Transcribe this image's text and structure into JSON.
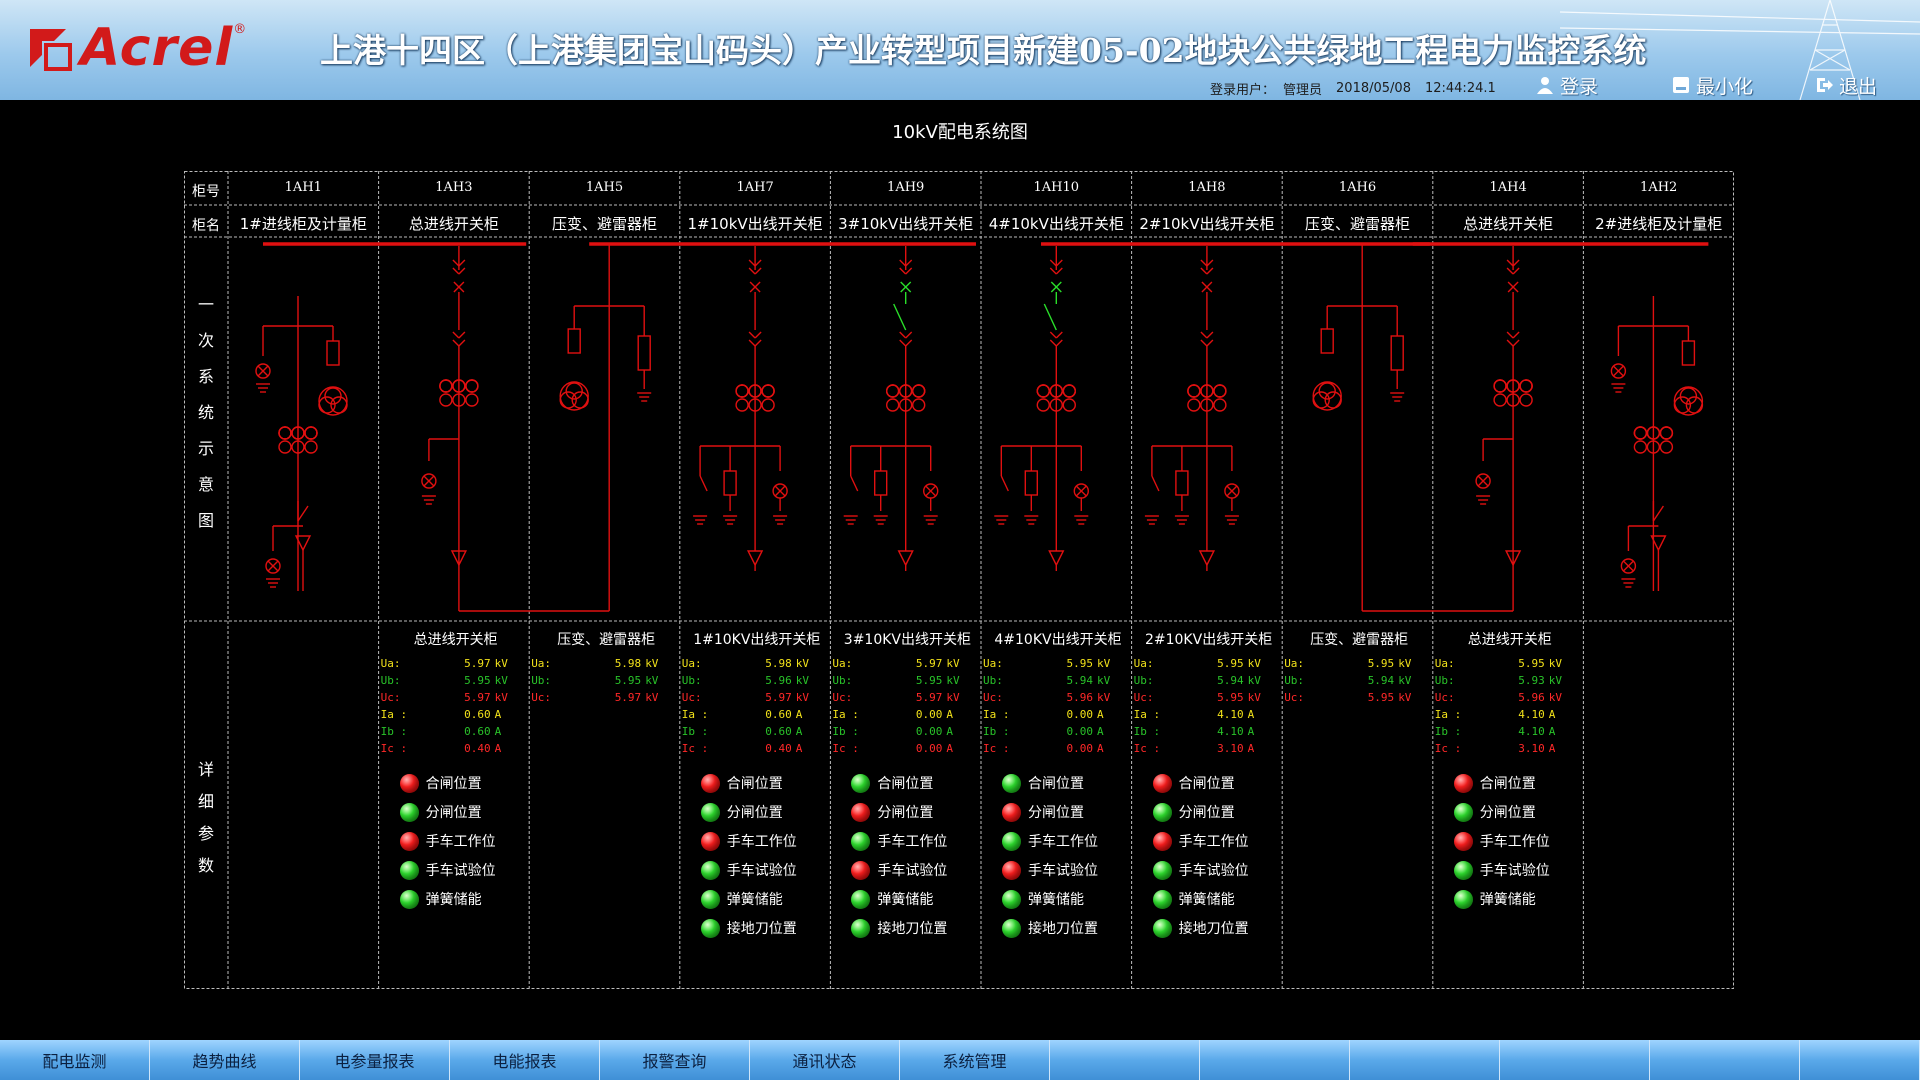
{
  "header": {
    "logo_text": "Acrel",
    "title": "上港十四区（上港集团宝山码头）产业转型项目新建05-02地块公共绿地工程电力监控系统",
    "user_label": "登录用户：",
    "user": "管理员",
    "date": "2018/05/08",
    "time": "12:44:24.1",
    "login_label": "登录",
    "minimize_label": "最小化",
    "exit_label": "退出"
  },
  "page_title": "10kV配电系统图",
  "row_labels": {
    "cabinet_no": "柜号",
    "cabinet_name": "柜名"
  },
  "side_labels": {
    "diagram": [
      "一",
      "次",
      "系",
      "统",
      "示",
      "意",
      "图"
    ],
    "details": [
      "详",
      "细",
      "参",
      "数"
    ]
  },
  "cabinets": [
    {
      "no": "1AH1",
      "name": "1#进线柜及计量柜"
    },
    {
      "no": "1AH3",
      "name": "总进线开关柜"
    },
    {
      "no": "1AH5",
      "name": "压变、避雷器柜"
    },
    {
      "no": "1AH7",
      "name": "1#10kV出线开关柜"
    },
    {
      "no": "1AH9",
      "name": "3#10kV出线开关柜"
    },
    {
      "no": "1AH10",
      "name": "4#10kV出线开关柜"
    },
    {
      "no": "1AH8",
      "name": "2#10kV出线开关柜"
    },
    {
      "no": "1AH6",
      "name": "压变、避雷器柜"
    },
    {
      "no": "1AH4",
      "name": "总进线开关柜"
    },
    {
      "no": "1AH2",
      "name": "2#进线柜及计量柜"
    }
  ],
  "panels": [
    {
      "col": 1,
      "title": "总进线开关柜",
      "rows": [
        {
          "label": "Ua:",
          "value": "5.97",
          "unit": "kV",
          "color": "y"
        },
        {
          "label": "Ub:",
          "value": "5.95",
          "unit": "kV",
          "color": "g"
        },
        {
          "label": "Uc:",
          "value": "5.97",
          "unit": "kV",
          "color": "r"
        },
        {
          "label": "Ia :",
          "value": "0.60",
          "unit": "A",
          "color": "y"
        },
        {
          "label": "Ib :",
          "value": "0.60",
          "unit": "A",
          "color": "g"
        },
        {
          "label": "Ic :",
          "value": "0.40",
          "unit": "A",
          "color": "r"
        }
      ]
    },
    {
      "col": 2,
      "title": "压变、避雷器柜",
      "rows": [
        {
          "label": "Ua:",
          "value": "5.98",
          "unit": "kV",
          "color": "y"
        },
        {
          "label": "Ub:",
          "value": "5.95",
          "unit": "kV",
          "color": "g"
        },
        {
          "label": "Uc:",
          "value": "5.97",
          "unit": "kV",
          "color": "r"
        }
      ]
    },
    {
      "col": 3,
      "title": "1#10KV出线开关柜",
      "rows": [
        {
          "label": "Ua:",
          "value": "5.98",
          "unit": "kV",
          "color": "y"
        },
        {
          "label": "Ub:",
          "value": "5.96",
          "unit": "kV",
          "color": "g"
        },
        {
          "label": "Uc:",
          "value": "5.97",
          "unit": "kV",
          "color": "r"
        },
        {
          "label": "Ia :",
          "value": "0.60",
          "unit": "A",
          "color": "y"
        },
        {
          "label": "Ib :",
          "value": "0.60",
          "unit": "A",
          "color": "g"
        },
        {
          "label": "Ic :",
          "value": "0.40",
          "unit": "A",
          "color": "r"
        }
      ]
    },
    {
      "col": 4,
      "title": "3#10KV出线开关柜",
      "rows": [
        {
          "label": "Ua:",
          "value": "5.97",
          "unit": "kV",
          "color": "y"
        },
        {
          "label": "Ub:",
          "value": "5.95",
          "unit": "kV",
          "color": "g"
        },
        {
          "label": "Uc:",
          "value": "5.97",
          "unit": "kV",
          "color": "r"
        },
        {
          "label": "Ia :",
          "value": "0.00",
          "unit": "A",
          "color": "y"
        },
        {
          "label": "Ib :",
          "value": "0.00",
          "unit": "A",
          "color": "g"
        },
        {
          "label": "Ic :",
          "value": "0.00",
          "unit": "A",
          "color": "r"
        }
      ]
    },
    {
      "col": 5,
      "title": "4#10KV出线开关柜",
      "rows": [
        {
          "label": "Ua:",
          "value": "5.95",
          "unit": "kV",
          "color": "y"
        },
        {
          "label": "Ub:",
          "value": "5.94",
          "unit": "kV",
          "color": "g"
        },
        {
          "label": "Uc:",
          "value": "5.96",
          "unit": "kV",
          "color": "r"
        },
        {
          "label": "Ia :",
          "value": "0.00",
          "unit": "A",
          "color": "y"
        },
        {
          "label": "Ib :",
          "value": "0.00",
          "unit": "A",
          "color": "g"
        },
        {
          "label": "Ic :",
          "value": "0.00",
          "unit": "A",
          "color": "r"
        }
      ]
    },
    {
      "col": 6,
      "title": "2#10KV出线开关柜",
      "rows": [
        {
          "label": "Ua:",
          "value": "5.95",
          "unit": "kV",
          "color": "y"
        },
        {
          "label": "Ub:",
          "value": "5.94",
          "unit": "kV",
          "color": "g"
        },
        {
          "label": "Uc:",
          "value": "5.95",
          "unit": "kV",
          "color": "r"
        },
        {
          "label": "Ia :",
          "value": "4.10",
          "unit": "A",
          "color": "y"
        },
        {
          "label": "Ib :",
          "value": "4.10",
          "unit": "A",
          "color": "g"
        },
        {
          "label": "Ic :",
          "value": "3.10",
          "unit": "A",
          "color": "r"
        }
      ]
    },
    {
      "col": 7,
      "title": "压变、避雷器柜",
      "rows": [
        {
          "label": "Ua:",
          "value": "5.95",
          "unit": "kV",
          "color": "y"
        },
        {
          "label": "Ub:",
          "value": "5.94",
          "unit": "kV",
          "color": "g"
        },
        {
          "label": "Uc:",
          "value": "5.95",
          "unit": "kV",
          "color": "r"
        }
      ]
    },
    {
      "col": 8,
      "title": "总进线开关柜",
      "rows": [
        {
          "label": "Ua:",
          "value": "5.95",
          "unit": "kV",
          "color": "y"
        },
        {
          "label": "Ub:",
          "value": "5.93",
          "unit": "kV",
          "color": "g"
        },
        {
          "label": "Uc:",
          "value": "5.96",
          "unit": "kV",
          "color": "r"
        },
        {
          "label": "Ia :",
          "value": "4.10",
          "unit": "A",
          "color": "y"
        },
        {
          "label": "Ib :",
          "value": "4.10",
          "unit": "A",
          "color": "g"
        },
        {
          "label": "Ic :",
          "value": "3.10",
          "unit": "A",
          "color": "r"
        }
      ]
    }
  ],
  "status": [
    {
      "col": 1,
      "items": [
        {
          "label": "合闸位置",
          "state": "red"
        },
        {
          "label": "分闸位置",
          "state": "green"
        },
        {
          "label": "手车工作位",
          "state": "red"
        },
        {
          "label": "手车试验位",
          "state": "green"
        },
        {
          "label": "弹簧储能",
          "state": "green"
        }
      ]
    },
    {
      "col": 3,
      "items": [
        {
          "label": "合闸位置",
          "state": "red"
        },
        {
          "label": "分闸位置",
          "state": "green"
        },
        {
          "label": "手车工作位",
          "state": "red"
        },
        {
          "label": "手车试验位",
          "state": "green"
        },
        {
          "label": "弹簧储能",
          "state": "green"
        },
        {
          "label": "接地刀位置",
          "state": "green"
        }
      ]
    },
    {
      "col": 4,
      "items": [
        {
          "label": "合闸位置",
          "state": "green"
        },
        {
          "label": "分闸位置",
          "state": "red"
        },
        {
          "label": "手车工作位",
          "state": "green"
        },
        {
          "label": "手车试验位",
          "state": "red"
        },
        {
          "label": "弹簧储能",
          "state": "green"
        },
        {
          "label": "接地刀位置",
          "state": "green"
        }
      ]
    },
    {
      "col": 5,
      "items": [
        {
          "label": "合闸位置",
          "state": "green"
        },
        {
          "label": "分闸位置",
          "state": "red"
        },
        {
          "label": "手车工作位",
          "state": "green"
        },
        {
          "label": "手车试验位",
          "state": "red"
        },
        {
          "label": "弹簧储能",
          "state": "green"
        },
        {
          "label": "接地刀位置",
          "state": "green"
        }
      ]
    },
    {
      "col": 6,
      "items": [
        {
          "label": "合闸位置",
          "state": "red"
        },
        {
          "label": "分闸位置",
          "state": "green"
        },
        {
          "label": "手车工作位",
          "state": "red"
        },
        {
          "label": "手车试验位",
          "state": "green"
        },
        {
          "label": "弹簧储能",
          "state": "green"
        },
        {
          "label": "接地刀位置",
          "state": "green"
        }
      ]
    },
    {
      "col": 8,
      "items": [
        {
          "label": "合闸位置",
          "state": "red"
        },
        {
          "label": "分闸位置",
          "state": "green"
        },
        {
          "label": "手车工作位",
          "state": "red"
        },
        {
          "label": "手车试验位",
          "state": "green"
        },
        {
          "label": "弹簧储能",
          "state": "green"
        }
      ]
    }
  ],
  "nav": [
    "配电监测",
    "趋势曲线",
    "电参量报表",
    "电能报表",
    "报警查询",
    "通讯状态",
    "系统管理",
    "",
    "",
    "",
    "",
    "",
    ""
  ],
  "colors": {
    "line": "#e01010",
    "closed": "#e01010",
    "open": "#2adf2a"
  }
}
